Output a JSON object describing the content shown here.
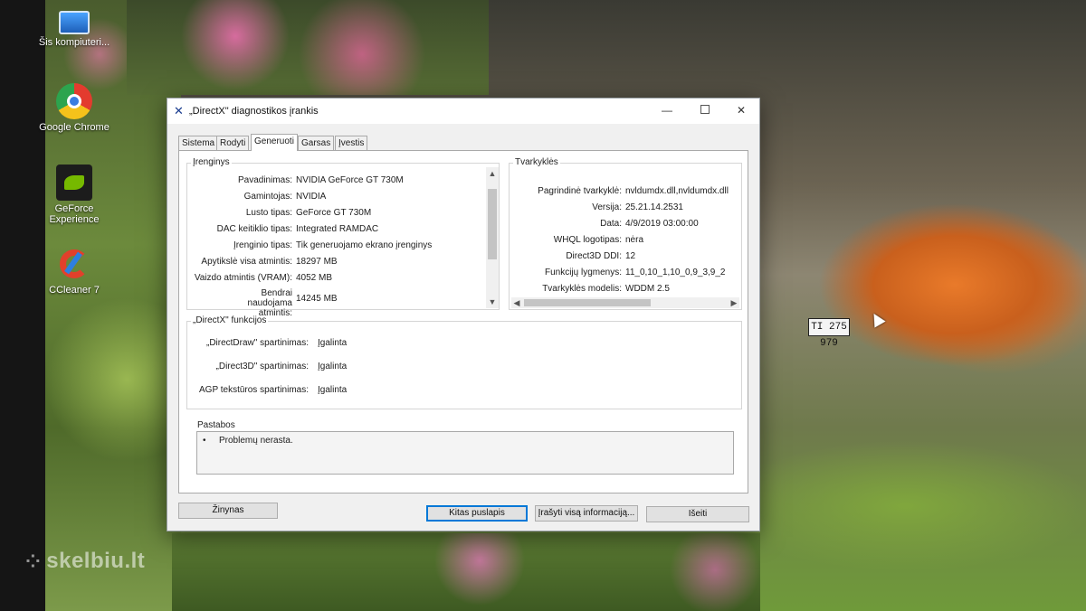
{
  "desktop": {
    "icons": [
      {
        "label": "Šis kompiuteri...",
        "icon": "this-pc-icon"
      },
      {
        "label": "Google Chrome",
        "icon": "chrome-icon"
      },
      {
        "label": "GeForce Experience",
        "icon": "nvidia-icon"
      },
      {
        "label": "CCleaner 7",
        "icon": "ccleaner-icon"
      }
    ],
    "watermark": "skelbiu.lt",
    "license_plate": "TI 275 979"
  },
  "window": {
    "title": "„DirectX\" diagnostikos įrankis",
    "controls": {
      "minimize": "—",
      "close": "✕"
    },
    "tabs": [
      "Sistema",
      "Rodyti",
      "Generuoti",
      "Garsas",
      "Įvestis"
    ],
    "active_tab": "Generuoti",
    "device": {
      "legend": "Įrenginys",
      "rows": [
        {
          "label": "Pavadinimas:",
          "value": "NVIDIA GeForce GT 730M"
        },
        {
          "label": "Gamintojas:",
          "value": "NVIDIA"
        },
        {
          "label": "Lusto tipas:",
          "value": "GeForce GT 730M"
        },
        {
          "label": "DAC keitiklio tipas:",
          "value": "Integrated RAMDAC"
        },
        {
          "label": "Įrenginio tipas:",
          "value": "Tik generuojamo ekrano įrenginys"
        },
        {
          "label": "Apytikslė visa atmintis:",
          "value": "18297 MB"
        },
        {
          "label": "Vaizdo atmintis (VRAM):",
          "value": "4052 MB"
        },
        {
          "label": "Bendrai naudojama atmintis:",
          "value": "14245 MB"
        }
      ]
    },
    "drivers": {
      "legend": "Tvarkyklės",
      "rows": [
        {
          "label": "Pagrindinė tvarkyklė:",
          "value": "nvldumdx.dll,nvldumdx.dll"
        },
        {
          "label": "Versija:",
          "value": "25.21.14.2531"
        },
        {
          "label": "Data:",
          "value": "4/9/2019 03:00:00"
        },
        {
          "label": "WHQL logotipas:",
          "value": "nėra"
        },
        {
          "label": "Direct3D DDI:",
          "value": "12"
        },
        {
          "label": "Funkcijų lygmenys:",
          "value": "11_0,10_1,10_0,9_3,9_2"
        },
        {
          "label": "Tvarkyklės modelis:",
          "value": "WDDM 2.5"
        }
      ]
    },
    "features": {
      "legend": "„DirectX\" funkcijos",
      "rows": [
        {
          "label": "„DirectDraw\" spartinimas:",
          "value": "Įgalinta"
        },
        {
          "label": "„Direct3D\" spartinimas:",
          "value": "Įgalinta"
        },
        {
          "label": "AGP tekstūros spartinimas:",
          "value": "Įgalinta"
        }
      ]
    },
    "notes": {
      "legend": "Pastabos",
      "items": [
        "Problemų nerasta."
      ]
    },
    "buttons": {
      "help": "Žinynas",
      "next_page": "Kitas puslapis",
      "save_all": "Įrašyti visą informaciją...",
      "exit": "Išeiti"
    }
  }
}
